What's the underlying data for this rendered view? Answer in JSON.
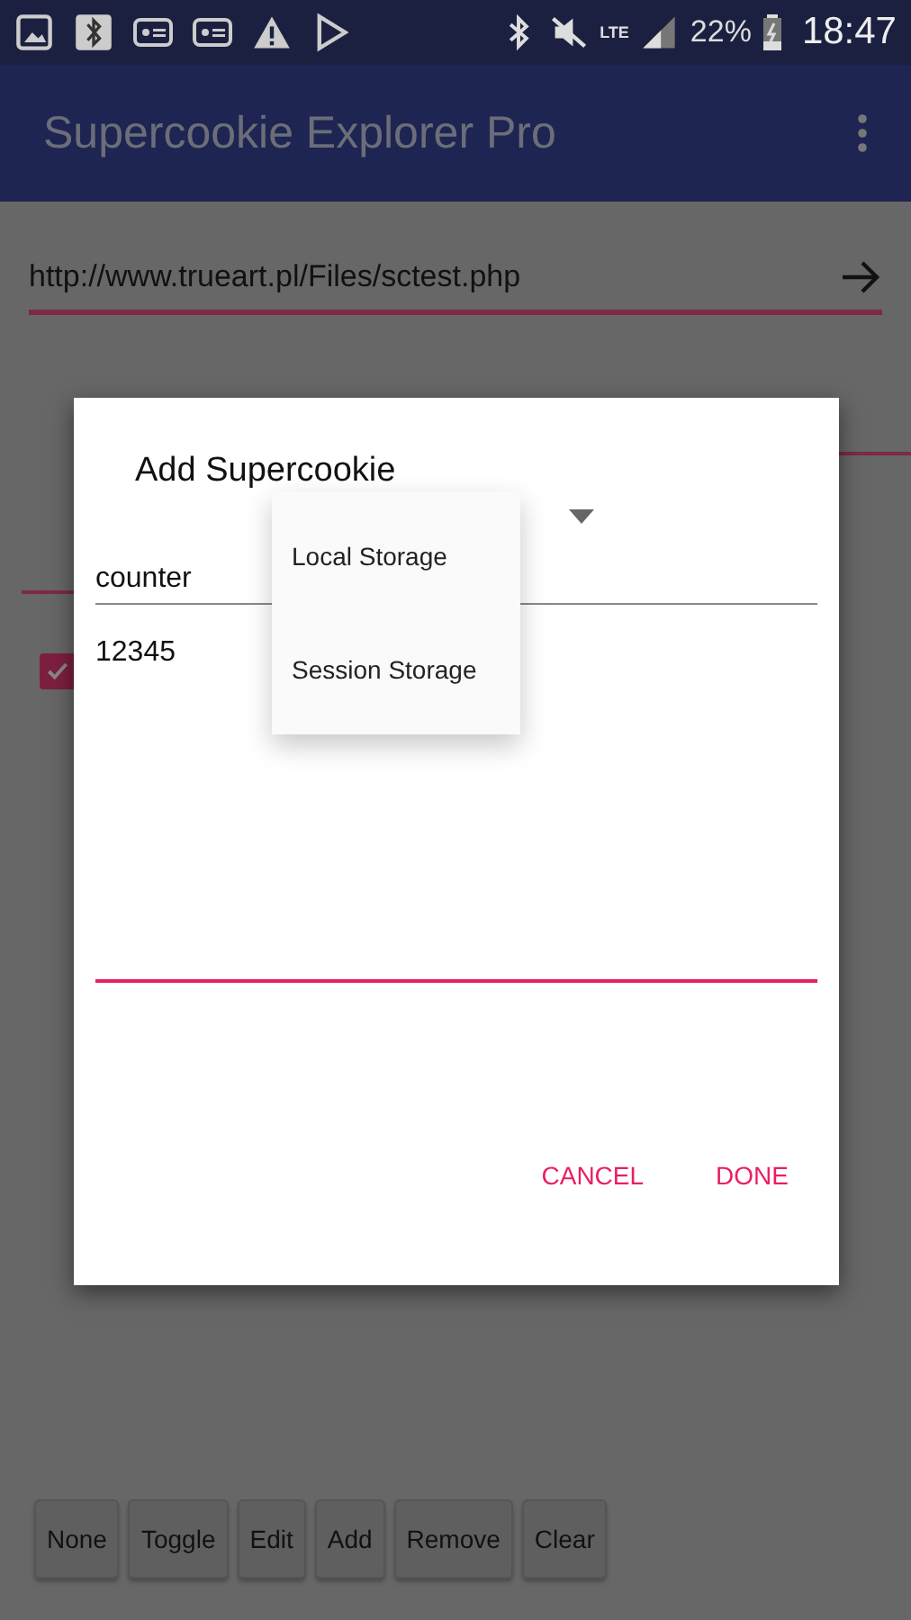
{
  "status_bar": {
    "network": "LTE",
    "battery": "22%",
    "time": "18:47"
  },
  "app_bar": {
    "title": "Supercookie Explorer Pro"
  },
  "url_field": {
    "value": "http://www.trueart.pl/Files/sctest.php"
  },
  "list": {
    "checkbox": {
      "checked": true
    }
  },
  "buttons": [
    "None",
    "Toggle",
    "Edit",
    "Add",
    "Remove",
    "Clear"
  ],
  "dialog": {
    "title": "Add Supercookie",
    "name_field": {
      "value": "counter"
    },
    "value_field": {
      "value": "12345"
    },
    "actions": [
      "CANCEL",
      "DONE"
    ]
  },
  "dropdown_menu": {
    "items": [
      "Local Storage",
      "Session Storage"
    ]
  }
}
